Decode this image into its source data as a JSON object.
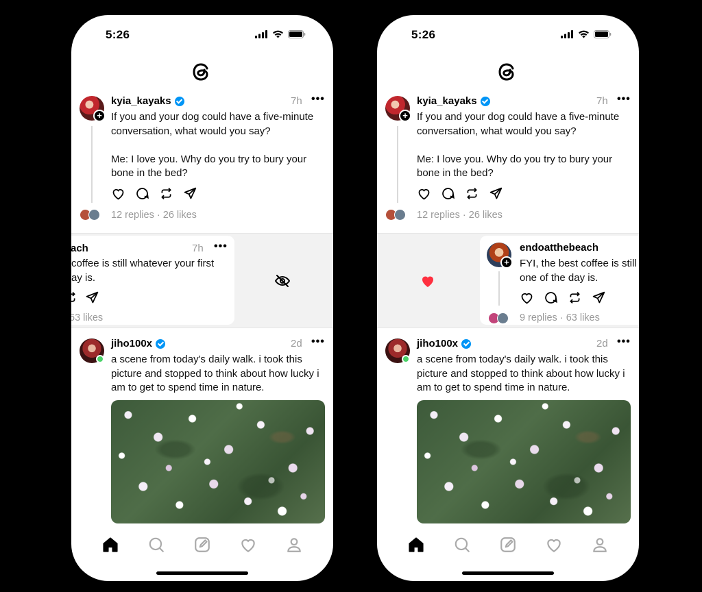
{
  "status": {
    "time": "5:26"
  },
  "posts": {
    "kyia": {
      "username": "kyia_kayaks",
      "time": "7h",
      "text": "If you and your dog could have a five-minute conversation, what would you say?\n\nMe: I love you. Why do you try to bury your bone in the bed?",
      "stats": "12 replies · 26 likes"
    },
    "endo": {
      "username": "endoatthebeach",
      "username_clipped": "ach",
      "time": "7h",
      "text": "FYI, the best coffee is still one of the day is.",
      "text_line1": "FYI, the best coffee is still",
      "text_line2": "one of the day is.",
      "text_clipped_line1": "coffee is still whatever your first",
      "text_clipped_line2": "ay is.",
      "stats": "9 replies · 63 likes",
      "stats_clipped": "63 likes"
    },
    "jiho": {
      "username": "jiho100x",
      "time": "2d",
      "text": "a scene from today's daily walk. i took this picture and stopped to think about how lucky i am to get to spend time in nature."
    }
  },
  "colors": {
    "verified": "#0095f6",
    "like": "#ff3040",
    "online": "#4cd36a"
  },
  "icons": {
    "left_swipe_action": "hide-eye-icon",
    "right_swipe_action": "heart-filled-icon",
    "nav": [
      "home-icon",
      "search-icon",
      "compose-icon",
      "heart-icon",
      "profile-icon"
    ]
  }
}
